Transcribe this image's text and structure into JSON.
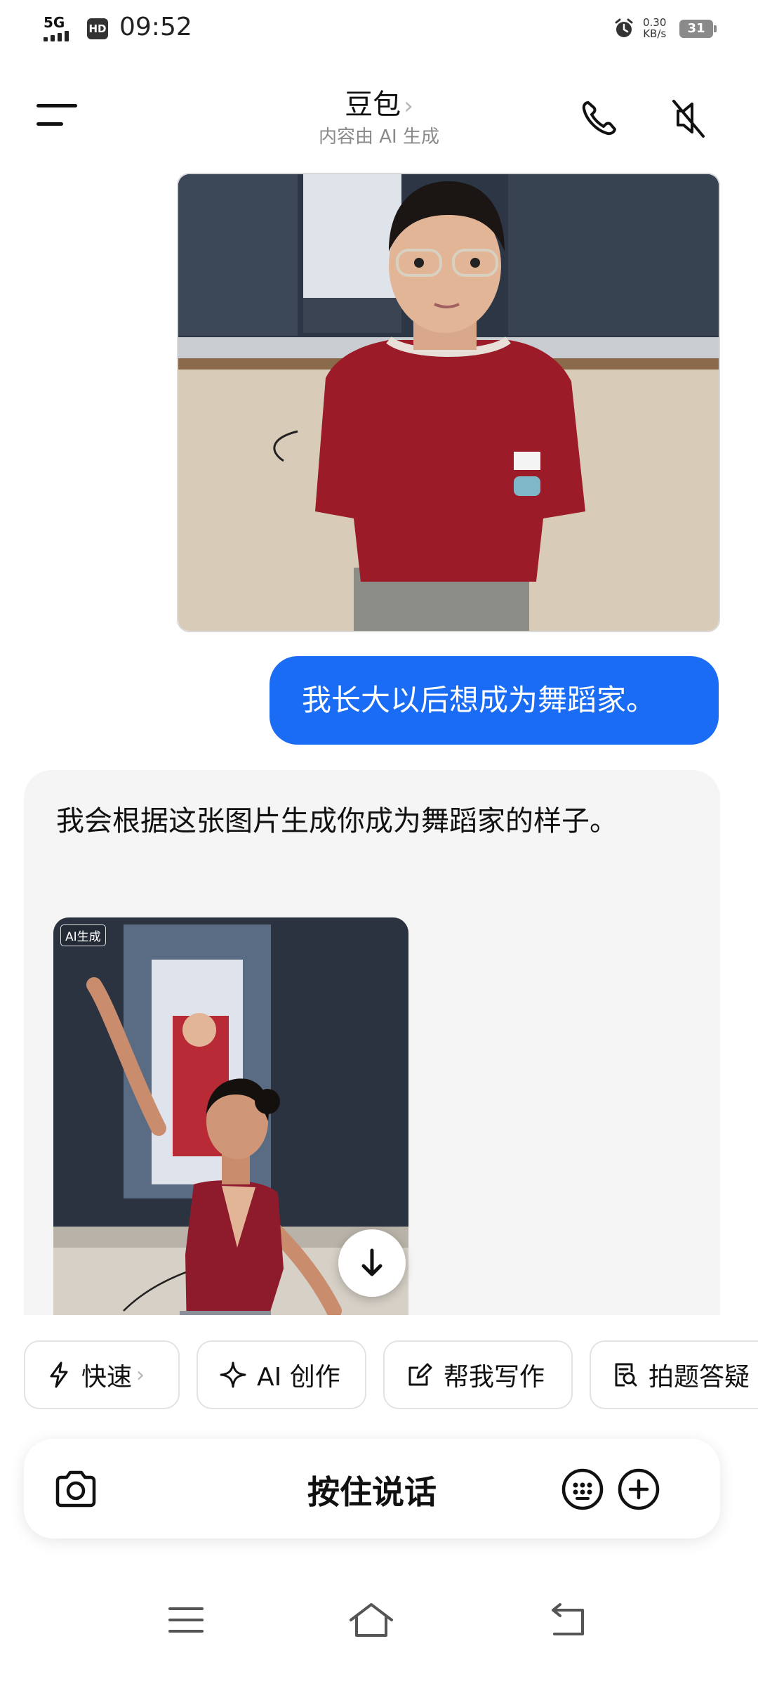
{
  "status_bar": {
    "network": "5G",
    "hd": "HD",
    "time": "09:52",
    "speed_value": "0.30",
    "speed_unit": "KB/s",
    "battery": "31"
  },
  "header": {
    "title": "豆包",
    "title_chevron": "›",
    "subtitle": "内容由 AI 生成",
    "icons": [
      "menu-icon",
      "phone-icon",
      "speaker-muted-icon"
    ]
  },
  "chat": {
    "user_image_icon": "photo-girl-red-shirt",
    "user_message": "我长大以后想成为舞蹈家。",
    "bot_reply": "我会根据这张图片生成你成为舞蹈家的样子。",
    "generated_image": {
      "badge": "AI生成",
      "icon": "photo-ballet-dancer"
    },
    "scroll_down_icon": "arrow-down-icon"
  },
  "quick_actions": [
    {
      "label": "快速",
      "icon": "lightning-icon",
      "chevron": "›"
    },
    {
      "label": "AI 创作",
      "icon": "sparkle-icon"
    },
    {
      "label": "帮我写作",
      "icon": "edit-icon"
    },
    {
      "label": "拍题答疑",
      "icon": "document-search-icon"
    }
  ],
  "input_bar": {
    "talk_label": "按住说话",
    "icons": [
      "camera-icon",
      "emoji-keyboard-icon",
      "plus-icon"
    ]
  },
  "nav_bar": {
    "icons": [
      "recents-icon",
      "home-icon",
      "back-icon"
    ]
  },
  "colors": {
    "user_bubble": "#1a6cf5",
    "reply_bg": "#f5f5f5",
    "shirt_red": "#9b1c28"
  }
}
